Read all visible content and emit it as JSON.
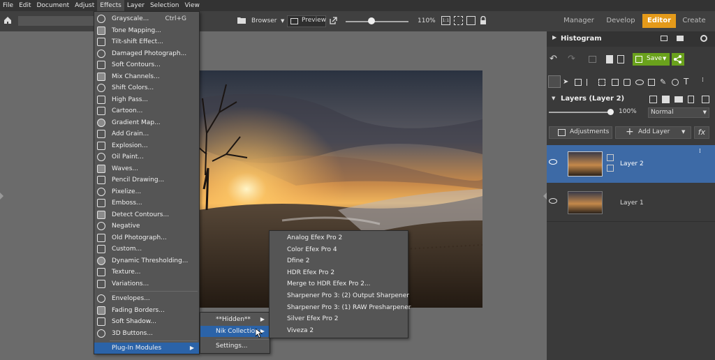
{
  "menubar": {
    "items": [
      "File",
      "Edit",
      "Document",
      "Adjust",
      "Effects",
      "Layer",
      "Selection",
      "View"
    ],
    "active_index": 4
  },
  "toolbar": {
    "browser_label": "Browser",
    "preview_label": "Preview",
    "zoom_text": "110%",
    "zoom_fraction": 0.42,
    "ratio_1_label": "1:1"
  },
  "modes": {
    "items": [
      "Manager",
      "Develop",
      "Editor",
      "Create"
    ],
    "active_index": 2
  },
  "right_panel": {
    "histogram_title": "Histogram",
    "save_label": "Save",
    "layers_title": "Layers (Layer 2)",
    "opacity_text": "100%",
    "opacity_fraction": 1.0,
    "blend_mode": "Normal",
    "adjustments_label": "Adjustments",
    "add_layer_label": "Add Layer",
    "fx_label": "fx",
    "layers": [
      {
        "name": "Layer 2",
        "selected": true
      },
      {
        "name": "Layer 1",
        "selected": false
      }
    ]
  },
  "effects_menu": {
    "items": [
      {
        "label": "Grayscale...",
        "shortcut": "Ctrl+G",
        "icon": "grayscale-icon"
      },
      {
        "label": "Tone Mapping...",
        "icon": "tone-mapping-icon"
      },
      {
        "label": "Tilt-shift Effect...",
        "icon": "tilt-shift-icon"
      },
      {
        "label": "Damaged Photograph...",
        "icon": "damaged-photo-icon"
      },
      {
        "label": "Soft Contours...",
        "icon": "soft-contours-icon"
      },
      {
        "label": "Mix Channels...",
        "icon": "mix-channels-icon"
      },
      {
        "label": "Shift Colors...",
        "icon": "shift-colors-icon"
      },
      {
        "label": "High Pass...",
        "icon": "high-pass-icon"
      },
      {
        "label": "Cartoon...",
        "icon": "cartoon-icon"
      },
      {
        "label": "Gradient Map...",
        "icon": "gradient-map-icon"
      },
      {
        "label": "Add Grain...",
        "icon": "add-grain-icon"
      },
      {
        "label": "Explosion...",
        "icon": "explosion-icon"
      },
      {
        "label": "Oil Paint...",
        "icon": "oil-paint-icon"
      },
      {
        "label": "Waves...",
        "icon": "waves-icon"
      },
      {
        "label": "Pencil Drawing...",
        "icon": "pencil-icon"
      },
      {
        "label": "Pixelize...",
        "icon": "pixelize-icon"
      },
      {
        "label": "Emboss...",
        "icon": "emboss-icon"
      },
      {
        "label": "Detect Contours...",
        "icon": "detect-contours-icon"
      },
      {
        "label": "Negative",
        "icon": "negative-icon"
      },
      {
        "label": "Old Photograph...",
        "icon": "old-photo-icon"
      },
      {
        "label": "Custom...",
        "icon": "custom-grid-icon"
      },
      {
        "label": "Dynamic Thresholding...",
        "icon": "threshold-icon"
      },
      {
        "label": "Texture...",
        "icon": "texture-icon"
      },
      {
        "label": "Variations...",
        "icon": "variations-icon"
      }
    ],
    "items_b": [
      {
        "label": "Envelopes...",
        "icon": "envelopes-icon"
      },
      {
        "label": "Fading Borders...",
        "icon": "fading-borders-icon"
      },
      {
        "label": "Soft Shadow...",
        "icon": "soft-shadow-icon"
      },
      {
        "label": "3D Buttons...",
        "icon": "3d-buttons-icon"
      }
    ],
    "plugin_label": "Plug-In Modules"
  },
  "plugin_menu": {
    "items": [
      "**Hidden**",
      "Nik Collection",
      "Settings..."
    ]
  },
  "nik_menu": {
    "items": [
      "Analog Efex Pro 2",
      "Color Efex Pro 4",
      "Dfine 2",
      "HDR Efex Pro 2",
      "Merge to HDR Efex Pro 2...",
      "Sharpener Pro 3: (2) Output Sharpener",
      "Sharpener Pro 3: (1) RAW Presharpener",
      "Silver Efex Pro 2",
      "Viveza 2"
    ]
  }
}
